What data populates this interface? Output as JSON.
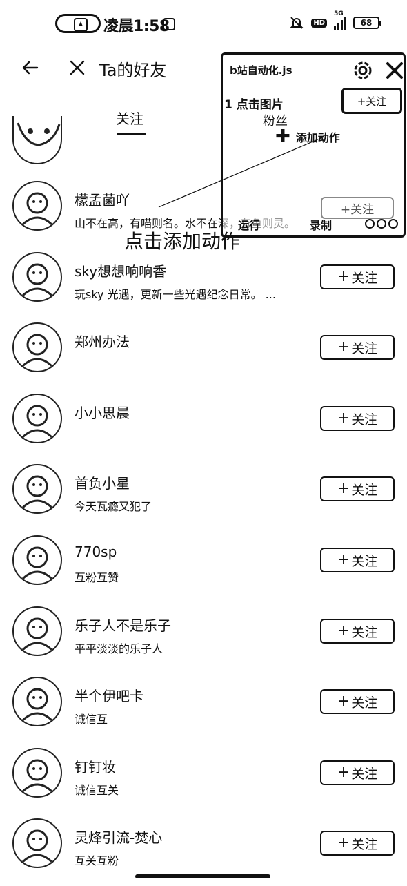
{
  "status_bar": {
    "time": "凌晨1:58",
    "hd": "HD",
    "network": "5G",
    "battery": "68"
  },
  "header": {
    "title": "Ta的好友"
  },
  "tabs": {
    "active": "关注"
  },
  "overlay": {
    "title": "b站自动化.js",
    "step_label": "1 点击图片",
    "fans_label": "粉丝",
    "add_action_label": "添加动作",
    "follow_label": "+关注",
    "run_label": "运行",
    "record_label": "录制",
    "hint_text": "点击添加动作"
  },
  "follow_button_label": "关注",
  "users": [
    {
      "name": "檬孟菌吖",
      "desc": "山不在高，有喵则名。水不在深，有鱼则灵。"
    },
    {
      "name": "sky想想响响香",
      "desc": "玩sky 光遇，更新一些光遇纪念日常。 ..."
    },
    {
      "name": "郑州办法",
      "desc": ""
    },
    {
      "name": "小小思晨",
      "desc": ""
    },
    {
      "name": "首负小星",
      "desc": "今天瓦瘾又犯了"
    },
    {
      "name": "770sp",
      "desc": "互粉互赞"
    },
    {
      "name": "乐子人不是乐子",
      "desc": "平平淡淡的乐子人"
    },
    {
      "name": "半个伊吧卡",
      "desc": "诚信互"
    },
    {
      "name": "钉钉妆",
      "desc": "诚信互关"
    },
    {
      "name": "灵烽引流-焚心",
      "desc": "互关互粉"
    }
  ]
}
